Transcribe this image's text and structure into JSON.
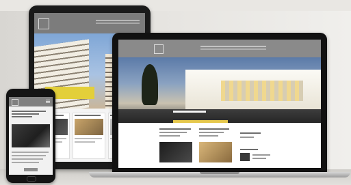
{
  "scene": {
    "devices": [
      "tablet",
      "laptop",
      "phone"
    ]
  },
  "tablet": {
    "logo_mark": "",
    "brand": "",
    "banner_text": ""
  },
  "laptop": {
    "logo_mark": "",
    "brand": ""
  },
  "phone": {
    "brand": ""
  },
  "colors": {
    "accent_yellow": "#e3cf3a",
    "header_gray": "#808080",
    "device_black": "#141414"
  }
}
